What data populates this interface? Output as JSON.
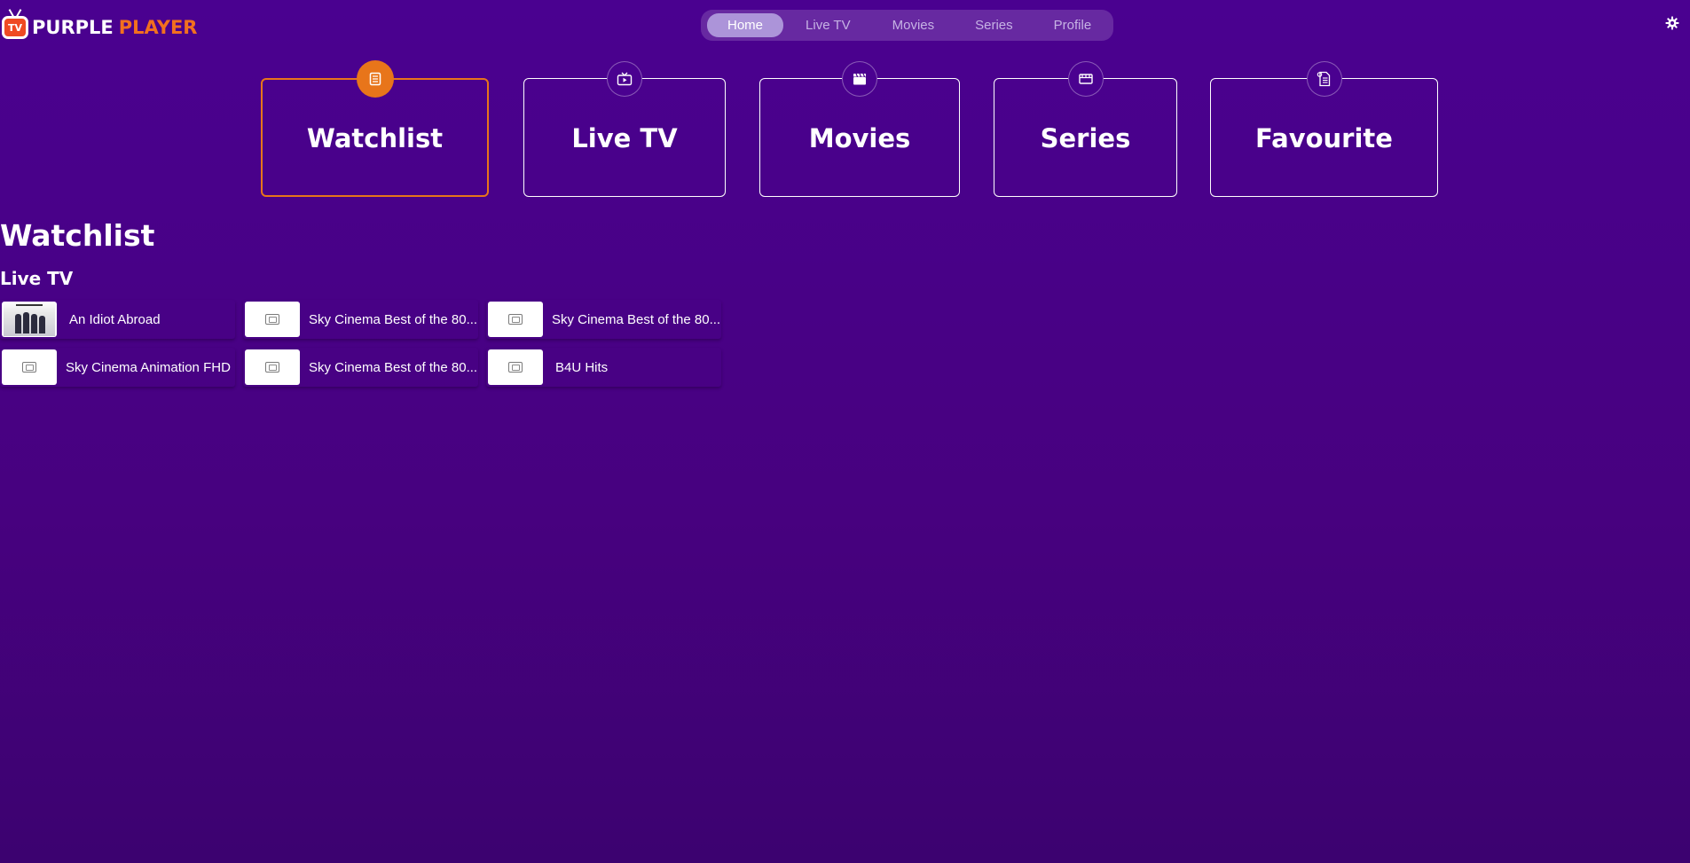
{
  "brand": {
    "tv_badge": "TV",
    "word1": "PURPLE",
    "word2": "PLAYER",
    "accent": "#e8751a"
  },
  "nav": {
    "items": [
      {
        "label": "Home",
        "active": true
      },
      {
        "label": "Live TV"
      },
      {
        "label": "Movies"
      },
      {
        "label": "Series"
      },
      {
        "label": "Profile"
      }
    ]
  },
  "settings_icon": "gear-icon",
  "categories": [
    {
      "label": "Watchlist",
      "icon": "list-icon",
      "active": true
    },
    {
      "label": "Live TV",
      "icon": "tv-play-icon"
    },
    {
      "label": "Movies",
      "icon": "clapperboard-icon"
    },
    {
      "label": "Series",
      "icon": "film-icon"
    },
    {
      "label": "Favourite",
      "icon": "document-list-icon"
    }
  ],
  "watchlist": {
    "title": "Watchlist",
    "live_tv_title": "Live TV",
    "items": [
      {
        "label": "An Idiot Abroad",
        "thumb": "poster"
      },
      {
        "label": "Sky Cinema Best of the 80...",
        "thumb": "placeholder-icon"
      },
      {
        "label": "Sky Cinema Best of the 80...",
        "thumb": "placeholder-icon"
      },
      {
        "label": "Sky Cinema Animation FHD",
        "thumb": "placeholder-icon"
      },
      {
        "label": "Sky Cinema Best of the 80...",
        "thumb": "placeholder-icon"
      },
      {
        "label": "B4U Hits",
        "thumb": "placeholder-icon"
      }
    ]
  }
}
